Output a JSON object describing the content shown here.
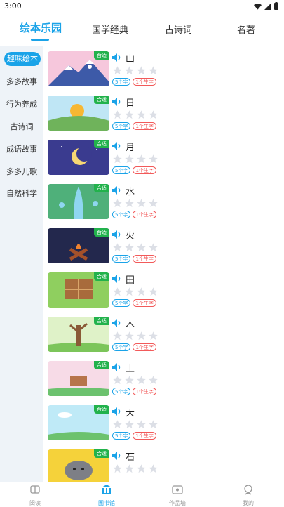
{
  "status": {
    "time": "3:00"
  },
  "topnav": {
    "tabs": [
      {
        "label": "绘本乐园"
      },
      {
        "label": "国学经典"
      },
      {
        "label": "古诗词"
      },
      {
        "label": "名著"
      }
    ]
  },
  "sidebar": {
    "items": [
      {
        "label": "趣味绘本"
      },
      {
        "label": "多多故事"
      },
      {
        "label": "行为养成"
      },
      {
        "label": "古诗词"
      },
      {
        "label": "成语故事"
      },
      {
        "label": "多多儿歌"
      },
      {
        "label": "自然科学"
      }
    ]
  },
  "cards": [
    {
      "title": "山",
      "badge": "合适",
      "words": "5个字",
      "new": "1个生字"
    },
    {
      "title": "日",
      "badge": "合适",
      "words": "5个字",
      "new": "1个生字"
    },
    {
      "title": "月",
      "badge": "合适",
      "words": "5个字",
      "new": "1个生字"
    },
    {
      "title": "水",
      "badge": "合适",
      "words": "5个字",
      "new": "1个生字"
    },
    {
      "title": "火",
      "badge": "合适",
      "words": "5个字",
      "new": "1个生字"
    },
    {
      "title": "田",
      "badge": "合适",
      "words": "5个字",
      "new": "1个生字"
    },
    {
      "title": "木",
      "badge": "合适",
      "words": "5个字",
      "new": "1个生字"
    },
    {
      "title": "土",
      "badge": "合适",
      "words": "5个字",
      "new": "1个生字"
    },
    {
      "title": "天",
      "badge": "合适",
      "words": "5个字",
      "new": "1个生字"
    },
    {
      "title": "石",
      "badge": "合适",
      "words": "",
      "new": ""
    }
  ],
  "bottom_nav": [
    {
      "label": "阅读",
      "icon": "book-icon"
    },
    {
      "label": "图书馆",
      "icon": "library-icon"
    },
    {
      "label": "作品墙",
      "icon": "tv-icon"
    },
    {
      "label": "我的",
      "icon": "profile-icon"
    }
  ],
  "colors": {
    "accent": "#1aa3e8",
    "badge_green": "#22b24c",
    "new_red": "#f25a5a"
  }
}
